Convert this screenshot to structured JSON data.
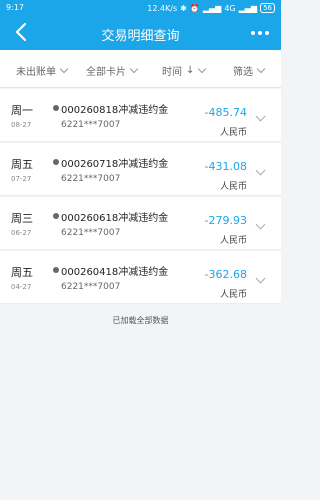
{
  "status_bar": {
    "time": "9:17",
    "network_speed": "12.4K/s",
    "network_type": "4G",
    "battery": "56"
  },
  "nav": {
    "title": "交易明细查询",
    "back_icon": "chevron-left-icon",
    "more_icon": "more-icon"
  },
  "filters": {
    "billing": "未出账单",
    "cards": "全部卡片",
    "time": "时间",
    "filter": "筛选"
  },
  "transactions": [
    {
      "weekday": "周一",
      "date": "08-27",
      "description": "000260818冲减违约金",
      "account": "6221***7007",
      "amount": "-485.74",
      "currency": "人民币"
    },
    {
      "weekday": "周五",
      "date": "07-27",
      "description": "000260718冲减违约金",
      "account": "6221***7007",
      "amount": "-431.08",
      "currency": "人民币"
    },
    {
      "weekday": "周三",
      "date": "06-27",
      "description": "000260618冲减违约金",
      "account": "6221***7007",
      "amount": "-279.93",
      "currency": "人民币"
    },
    {
      "weekday": "周五",
      "date": "04-27",
      "description": "000260418冲减违约金",
      "account": "6221***7007",
      "amount": "-362.68",
      "currency": "人民币"
    }
  ],
  "footer_text": "已加载全部数据",
  "colors": {
    "primary": "#1aa6e8",
    "amount": "#1aa6e8",
    "background": "#f3f4f6"
  }
}
